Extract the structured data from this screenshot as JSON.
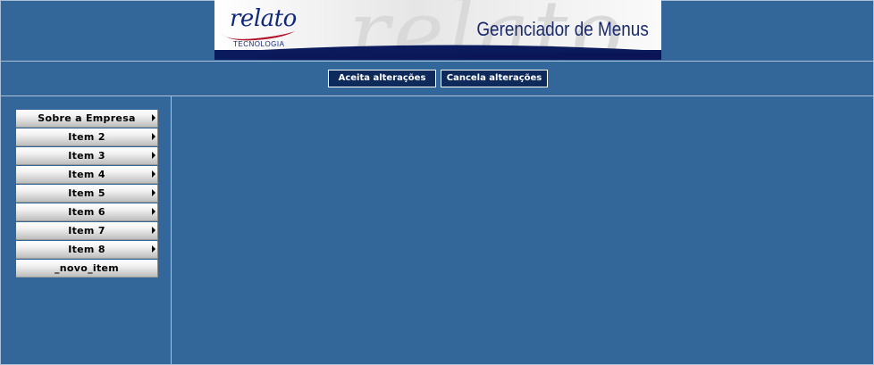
{
  "header": {
    "logo_word": "relato",
    "logo_subtitle": "TECNOLOGIA",
    "app_title": "Gerenciador de Menus",
    "watermark": "relato"
  },
  "actions": {
    "accept_label": "Aceita alterações",
    "cancel_label": "Cancela alterações"
  },
  "menu": {
    "items": [
      {
        "label": "Sobre a Empresa",
        "has_submenu": true
      },
      {
        "label": "Item 2",
        "has_submenu": true
      },
      {
        "label": "Item 3",
        "has_submenu": true
      },
      {
        "label": "Item 4",
        "has_submenu": true
      },
      {
        "label": "Item 5",
        "has_submenu": true
      },
      {
        "label": "Item 6",
        "has_submenu": true
      },
      {
        "label": "Item 7",
        "has_submenu": true
      },
      {
        "label": "Item 8",
        "has_submenu": true
      },
      {
        "label": "_novo_item",
        "has_submenu": false
      }
    ]
  },
  "colors": {
    "background": "#336699",
    "button_bg": "#0e2a5a",
    "separator": "#a9c0d8",
    "brand_navy": "#10297a",
    "brand_red": "#b3122a"
  }
}
